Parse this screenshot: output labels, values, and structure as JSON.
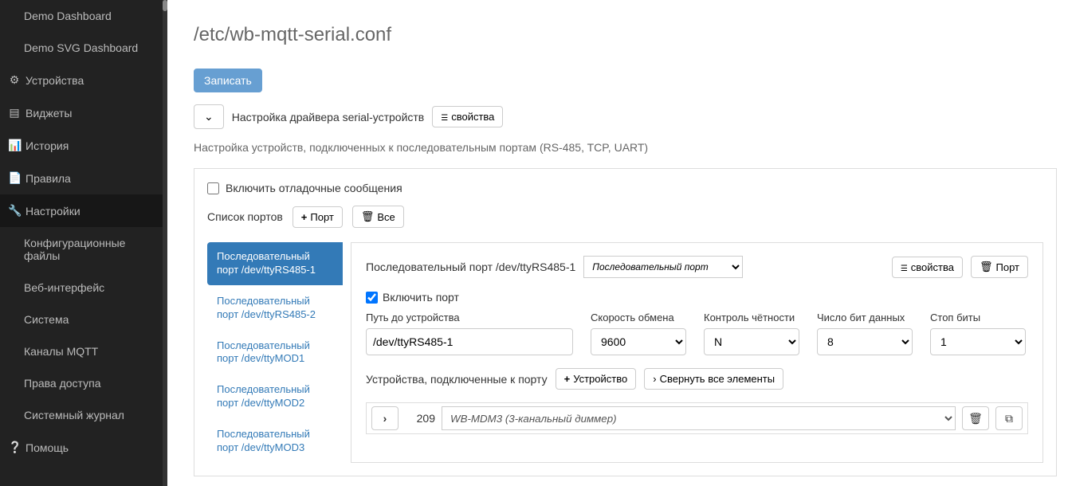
{
  "sidebar": {
    "items": [
      {
        "label": "Demo Dashboard",
        "icon": "",
        "sub": true
      },
      {
        "label": "Demo SVG Dashboard",
        "icon": "",
        "sub": true
      },
      {
        "label": "Устройства",
        "icon": "⚙"
      },
      {
        "label": "Виджеты",
        "icon": "▤"
      },
      {
        "label": "История",
        "icon": "📊"
      },
      {
        "label": "Правила",
        "icon": "📄"
      },
      {
        "label": "Настройки",
        "icon": "🔧",
        "active": true
      },
      {
        "label": "Конфигурационные файлы",
        "icon": "",
        "sub": true
      },
      {
        "label": "Веб-интерфейс",
        "icon": "",
        "sub": true
      },
      {
        "label": "Система",
        "icon": "",
        "sub": true
      },
      {
        "label": "Каналы MQTT",
        "icon": "",
        "sub": true
      },
      {
        "label": "Права доступа",
        "icon": "",
        "sub": true
      },
      {
        "label": "Системный журнал",
        "icon": "",
        "sub": true
      },
      {
        "label": "Помощь",
        "icon": "❔"
      }
    ]
  },
  "page": {
    "title": "/etc/wb-mqtt-serial.conf",
    "save_btn": "Записать",
    "driver_label": "Настройка драйвера serial-устройств",
    "props_btn": "свойства",
    "description": "Настройка устройств, подключенных к последовательным портам (RS-485, TCP, UART)",
    "debug_label": "Включить отладочные сообщения",
    "ports_list_label": "Список портов",
    "add_port_btn": "Порт",
    "all_btn": "Все"
  },
  "port_tabs": [
    {
      "label": "Последовательный порт /dev/ttyRS485-1",
      "active": true
    },
    {
      "label": "Последовательный порт /dev/ttyRS485-2"
    },
    {
      "label": "Последовательный порт /dev/ttyMOD1"
    },
    {
      "label": "Последовательный порт /dev/ttyMOD2"
    },
    {
      "label": "Последовательный порт /dev/ttyMOD3"
    }
  ],
  "detail": {
    "header_label": "Последовательный порт /dev/ttyRS485-1",
    "type_select": "Последовательный порт",
    "props_btn": "свойства",
    "delete_port_btn": "Порт",
    "enable_label": "Включить порт",
    "fields": {
      "path": {
        "label": "Путь до устройства",
        "value": "/dev/ttyRS485-1"
      },
      "baud": {
        "label": "Скорость обмена",
        "value": "9600"
      },
      "parity": {
        "label": "Контроль чётности",
        "value": "N"
      },
      "bits": {
        "label": "Число бит данных",
        "value": "8"
      },
      "stop": {
        "label": "Стоп биты",
        "value": "1"
      }
    },
    "devices_label": "Устройства, подключенные к порту",
    "add_device_btn": "Устройство",
    "collapse_btn": "Свернуть все элементы",
    "device": {
      "addr": "209",
      "name": "WB-MDM3 (3-канальный диммер)"
    }
  }
}
